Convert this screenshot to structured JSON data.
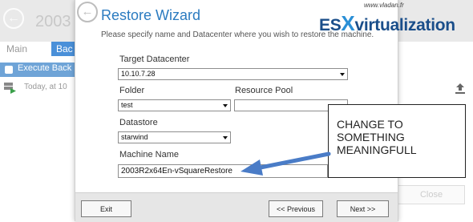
{
  "background_window": {
    "title": "2003",
    "tabs": [
      "Main",
      "Bac"
    ],
    "toolbar_action": "Execute Back",
    "status_text": "Today, at 10",
    "close_label": "Close"
  },
  "wizard": {
    "title": "Restore Wizard",
    "subtitle": "Please specify name and Datacenter where you wish to restore the machine.",
    "target_datacenter": {
      "label": "Target Datacenter",
      "value": "10.10.7.28"
    },
    "folder": {
      "label": "Folder",
      "value": "test"
    },
    "resource_pool": {
      "label": "Resource Pool",
      "value": ""
    },
    "datastore": {
      "label": "Datastore",
      "value": "starwind"
    },
    "machine_name": {
      "label": "Machine Name",
      "value": "2003R2x64En-vSquareRestore"
    },
    "buttons": {
      "exit": "Exit",
      "previous": "<< Previous",
      "next": "Next >>"
    }
  },
  "logo": {
    "url": "www.vladan.fr",
    "text_prefix": "ES",
    "text_x": "X",
    "text_suffix": "virtualization"
  },
  "annotation": {
    "lines": [
      "CHANGE TO",
      "SOMETHING",
      "MEANINGFULL"
    ]
  },
  "colors": {
    "title_blue": "#2b7bc0",
    "arrow_blue": "#4a7cc7",
    "logo_blue": "#1a4e8a"
  }
}
